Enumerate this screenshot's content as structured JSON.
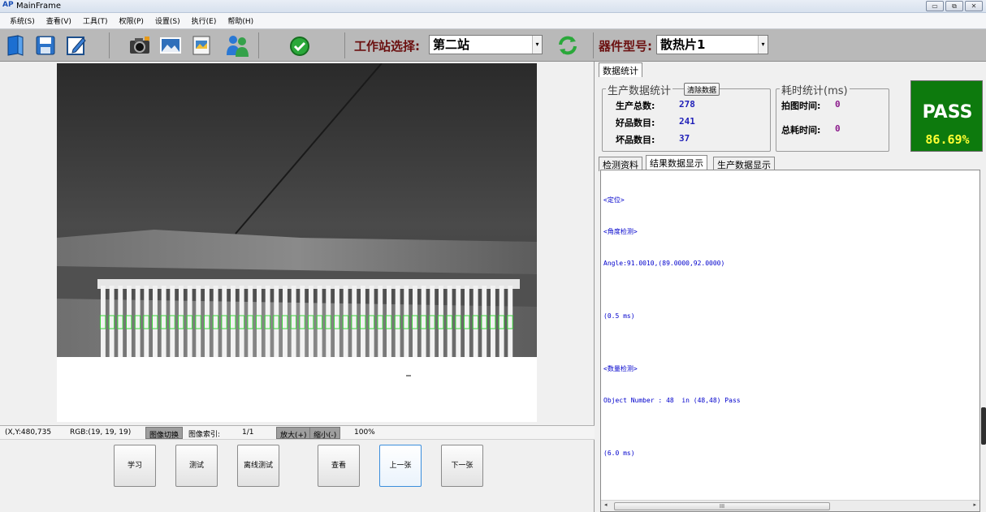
{
  "window": {
    "title": "MainFrame",
    "app_icon": "AP"
  },
  "window_controls": [
    "▭",
    "⧉",
    "✕"
  ],
  "menu": [
    "系统(S)",
    "查看(V)",
    "工具(T)",
    "权限(P)",
    "设置(S)",
    "执行(E)",
    "帮助(H)"
  ],
  "toolbar": {
    "icons": [
      "open-book-icon",
      "save-disk-icon",
      "edit-icon",
      "camera-icon",
      "picture-icon",
      "image-file-icon",
      "users-icon",
      "check-icon",
      "refresh-icon"
    ],
    "station_label": "工作站选择:",
    "station_value": "第二站",
    "part_label": "器件型号:",
    "part_value": "散热片1",
    "dropdown_arrow": "▾"
  },
  "status": {
    "coords": "(X,Y:480,735",
    "rgb": "RGB:(19, 19, 19)",
    "toggle_btn": "图像切换",
    "index_label": "图像索引:",
    "index_value": "1/1",
    "zoom_in": "放大(+)",
    "zoom_out": "缩小(-)",
    "zoom_value": "100%"
  },
  "actions": [
    "学习",
    "测试",
    "离线测试",
    "查看",
    "上一张",
    "下一张"
  ],
  "right": {
    "top_tab": "数据统计",
    "production": {
      "title": "生产数据统计",
      "clear_btn": "清除数据",
      "total_label": "生产总数:",
      "total_value": "278",
      "good_label": "好品数目:",
      "good_value": "241",
      "bad_label": "坏品数目:",
      "bad_value": "37"
    },
    "timing": {
      "title": "耗时统计(ms)",
      "capture_label": "拍图时间:",
      "capture_value": "0",
      "total_label": "总耗时间:",
      "total_value": "0"
    },
    "result": {
      "status": "PASS",
      "percent": "86.69%"
    },
    "tabs": [
      "检测资料",
      "结果数据显示",
      "生产数据显示"
    ],
    "result_lines": [
      "<定位>",
      "<角度检测>",
      "Angle:91.0010,(89.0000,92.0000)",
      "",
      "(0.5 ms)",
      "",
      "<数量检测>",
      "Object Number : 48  in (48,48) Pass",
      "",
      "(6.0 ms)"
    ],
    "scroll_grip": "III",
    "scroll_left": "◂",
    "scroll_right": "▸"
  },
  "colors": {
    "pass_green": "#0d7a0d",
    "pass_pct_yellow": "#ffff33",
    "label_dark_red": "#6b1010",
    "value_blue": "#1f1fb8",
    "time_purple": "#8b1a8b",
    "result_text_blue": "#0000cc",
    "fin_highlight": "#3cd43c"
  }
}
